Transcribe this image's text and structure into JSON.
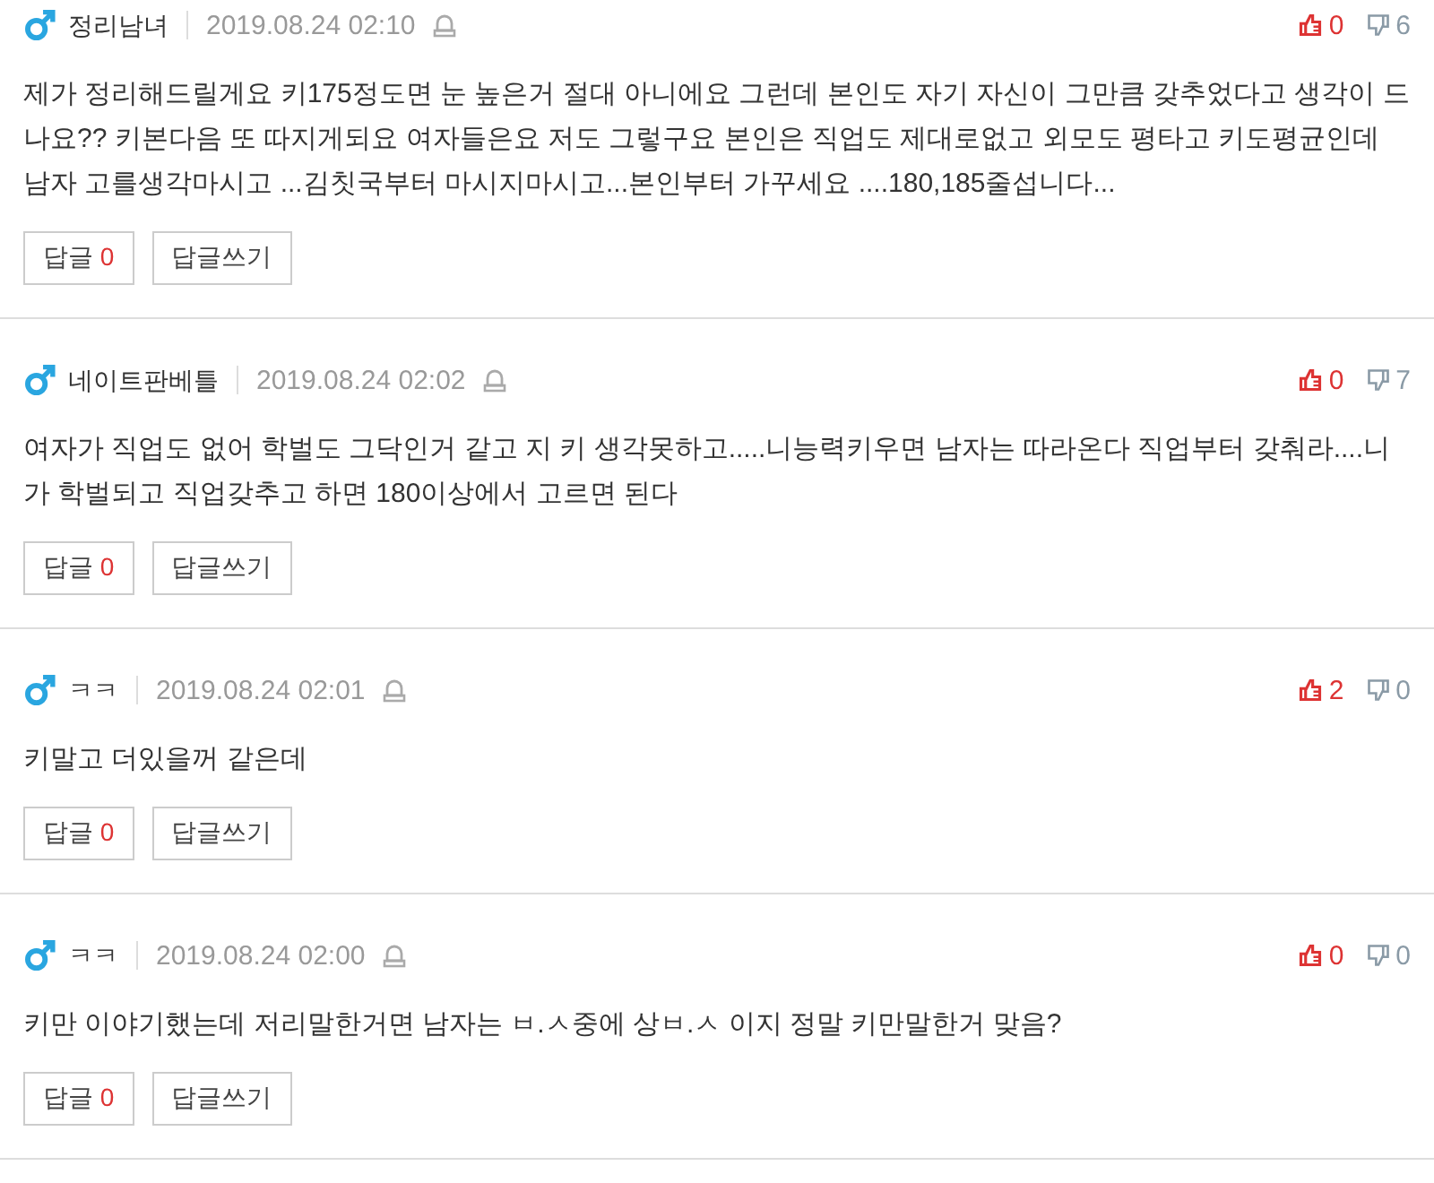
{
  "comments": [
    {
      "author": "정리남녀",
      "date": "2019.08.24 02:10",
      "likes": "0",
      "dislikes": "6",
      "text": "제가 정리해드릴게요 키175정도면 눈 높은거 절대 아니에요 그런데 본인도 자기 자신이 그만큼 갖추었다고 생각이 드나요?? 키본다음 또 따지게되요 여자들은요 저도 그렇구요 본인은 직업도 제대로없고 외모도 평타고 키도평균인데 남자 고를생각마시고 ...김칫국부터 마시지마시고...본인부터 가꾸세요 ....180,185줄섭니다...",
      "reply_label": "답글",
      "reply_count": "0",
      "write_label": "답글쓰기"
    },
    {
      "author": "네이트판베틀",
      "date": "2019.08.24 02:02",
      "likes": "0",
      "dislikes": "7",
      "text": "여자가 직업도 없어 학벌도 그닥인거 같고 지 키 생각못하고.....니능력키우면 남자는 따라온다 직업부터 갖춰라....니가 학벌되고 직업갖추고 하면 180이상에서 고르면 된다",
      "reply_label": "답글",
      "reply_count": "0",
      "write_label": "답글쓰기"
    },
    {
      "author": "ㅋㅋ",
      "date": "2019.08.24 02:01",
      "likes": "2",
      "dislikes": "0",
      "text": "키말고 더있을꺼 같은데",
      "reply_label": "답글",
      "reply_count": "0",
      "write_label": "답글쓰기"
    },
    {
      "author": "ㅋㅋ",
      "date": "2019.08.24 02:00",
      "likes": "0",
      "dislikes": "0",
      "text": "키만 이야기했는데 저리말한거면 남자는 ㅂ.ㅅ중에 상ㅂ.ㅅ 이지 정말 키만말한거 맞음?",
      "reply_label": "답글",
      "reply_count": "0",
      "write_label": "답글쓰기"
    }
  ]
}
